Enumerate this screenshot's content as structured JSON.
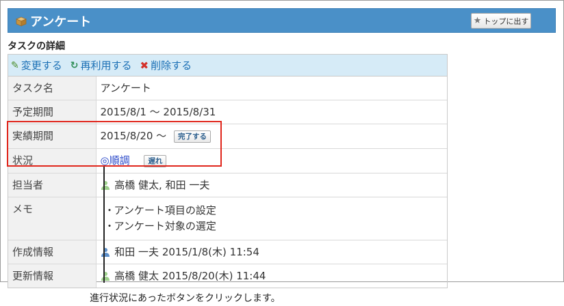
{
  "header": {
    "title": "アンケート",
    "top_button_label": "トップに出す"
  },
  "section_title": "タスクの詳細",
  "actions": [
    {
      "label": "変更する",
      "icon": "pencil-icon"
    },
    {
      "label": "再利用する",
      "icon": "recycle-icon"
    },
    {
      "label": "削除する",
      "icon": "delete-icon"
    }
  ],
  "rows": {
    "task_name": {
      "label": "タスク名",
      "value": "アンケート"
    },
    "planned_period": {
      "label": "予定期間",
      "value": "2015/8/1 ～ 2015/8/31"
    },
    "actual_period": {
      "label": "実績期間",
      "value": "2015/8/20 ～",
      "button": "完了する"
    },
    "status": {
      "label": "状況",
      "value": "◎順調",
      "button": "遅れ"
    },
    "assignee": {
      "label": "担当者",
      "value": "高橋 健太, 和田 一夫"
    },
    "memo": {
      "label": "メモ",
      "items": [
        "アンケート項目の設定",
        "アンケート対象の選定"
      ]
    },
    "created": {
      "label": "作成情報",
      "value": "和田 一夫 2015/1/8(木) 11:54"
    },
    "updated": {
      "label": "更新情報",
      "value": "高橋 健太 2015/8/20(木) 11:44"
    }
  },
  "callout": "進行状況にあったボタンをクリックします。",
  "colors": {
    "header_bg": "#4a90c8",
    "action_bar_bg": "#d6ebf7",
    "link": "#1a6fb5",
    "highlight": "#e0251b"
  }
}
